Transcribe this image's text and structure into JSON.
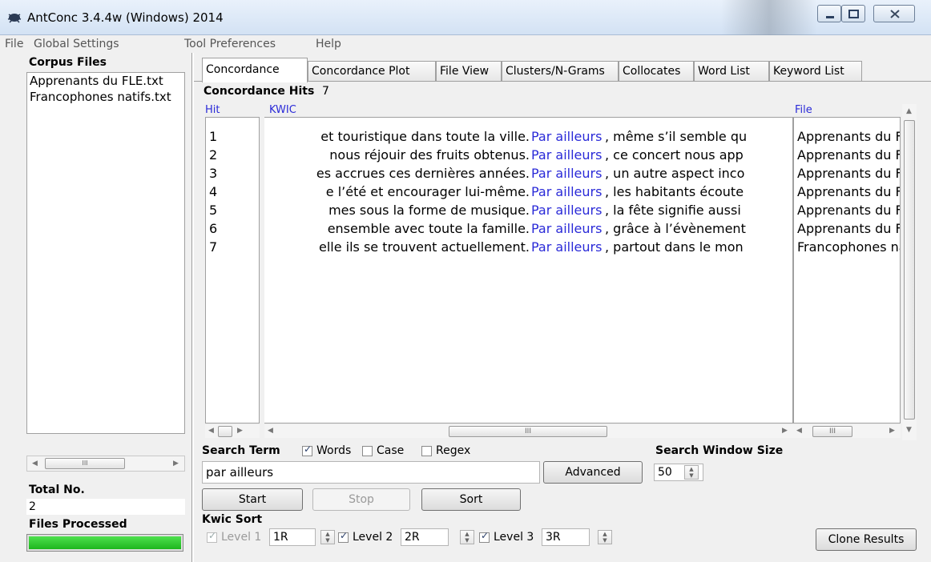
{
  "window": {
    "title": "AntConc 3.4.4w (Windows) 2014"
  },
  "menu": [
    "File",
    "Global Settings",
    "Tool Preferences",
    "Help"
  ],
  "left": {
    "corpus_title": "Corpus Files",
    "files": [
      "Apprenants du FLE.txt",
      "Francophones natifs.txt"
    ],
    "total_label": "Total No.",
    "total_value": "2",
    "processed_label": "Files Processed",
    "progress": 1.0
  },
  "tabs": [
    "Concordance",
    "Concordance Plot",
    "File View",
    "Clusters/N-Grams",
    "Collocates",
    "Word List",
    "Keyword List"
  ],
  "concordance": {
    "hits_label": "Concordance Hits",
    "hits_count": "7",
    "headers": {
      "hit": "Hit",
      "kwic": "KWIC",
      "file": "File"
    },
    "rows": [
      {
        "hit": "1",
        "left": "et touristique dans toute la ville.",
        "kw": "Par ailleurs",
        "right": ", même s’il semble qu",
        "file": "Apprenants du FLE.txt"
      },
      {
        "hit": "2",
        "left": "nous réjouir des fruits obtenus.",
        "kw": "Par ailleurs",
        "right": ", ce concert nous app",
        "file": "Apprenants du FLE.txt"
      },
      {
        "hit": "3",
        "left": "es accrues ces dernières années.",
        "kw": "Par ailleurs",
        "right": ", un autre aspect inco",
        "file": "Apprenants du FLE.txt"
      },
      {
        "hit": "4",
        "left": "e l’été et encourager lui-même.",
        "kw": "Par ailleurs",
        "right": ", les habitants écoute",
        "file": "Apprenants du FLE.txt"
      },
      {
        "hit": "5",
        "left": "mes sous la forme de musique.",
        "kw": "Par ailleurs",
        "right": ", la fête signifie aussi",
        "file": "Apprenants du FLE.txt"
      },
      {
        "hit": "6",
        "left": "ensemble avec toute la famille.",
        "kw": "Par ailleurs",
        "right": ", grâce à l’évènement",
        "file": "Apprenants du FLE.txt"
      },
      {
        "hit": "7",
        "left": "elle ils se trouvent actuellement.",
        "kw": "Par ailleurs",
        "right": ", partout dans le mon",
        "file": "Francophones natifs.txt"
      }
    ]
  },
  "search": {
    "term_label": "Search Term",
    "words_label": "Words",
    "words_checked": true,
    "case_label": "Case",
    "case_checked": false,
    "regex_label": "Regex",
    "regex_checked": false,
    "value": "par ailleurs",
    "advanced_label": "Advanced",
    "window_label": "Search Window Size",
    "window_value": "50",
    "start_label": "Start",
    "stop_label": "Stop",
    "sort_label": "Sort"
  },
  "kwic_sort": {
    "label": "Kwic Sort",
    "level1_label": "Level 1",
    "level1_value": "1R",
    "level2_label": "Level 2",
    "level2_value": "2R",
    "level3_label": "Level 3",
    "level3_value": "3R",
    "clone_label": "Clone Results"
  }
}
